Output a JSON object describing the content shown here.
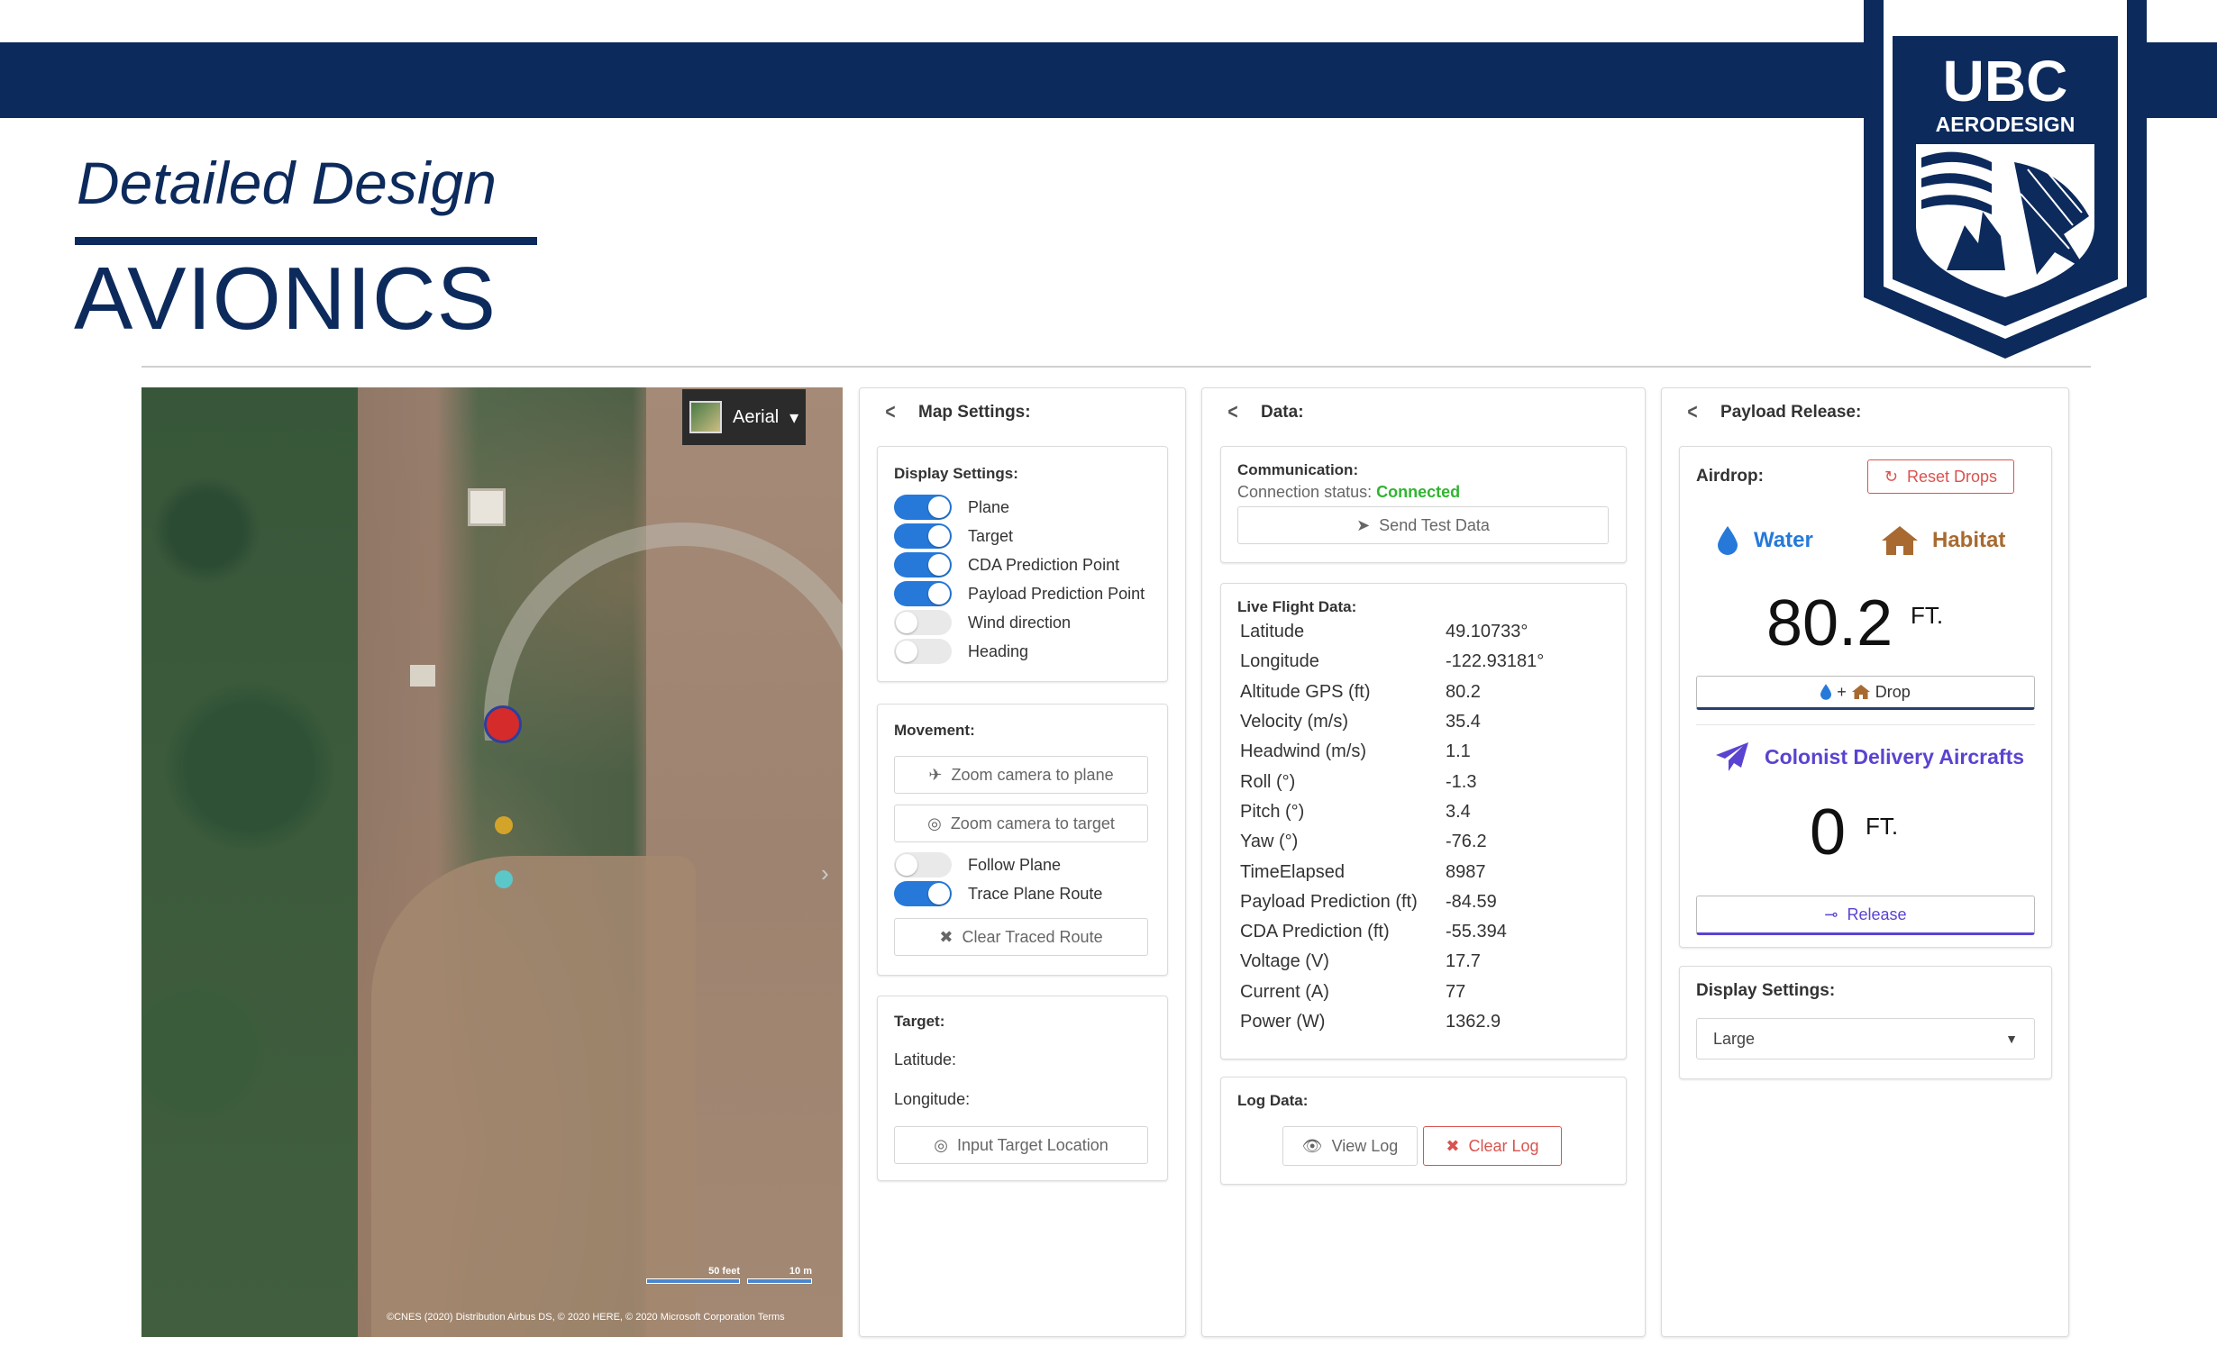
{
  "slide": {
    "subtitle": "Detailed Design",
    "title": "AVIONICS",
    "logo_line1": "UBC",
    "logo_line2": "AERODESIGN",
    "colors": {
      "navy": "#0c2a5c",
      "accent_blue": "#2679d9",
      "red": "#d9534f",
      "purple": "#5b43d1",
      "brown": "#b06a2b"
    }
  },
  "map": {
    "layer_label": "Aerial",
    "layer_icon": "chevron-down-icon",
    "scale_feet": "50 feet",
    "scale_meters": "10 m",
    "credit": "©CNES (2020) Distribution Airbus DS, © 2020 HERE, © 2020 Microsoft Corporation  Terms"
  },
  "map_settings": {
    "header": "Map Settings:",
    "display": {
      "title": "Display Settings:",
      "toggles": [
        {
          "label": "Plane",
          "on": true
        },
        {
          "label": "Target",
          "on": true
        },
        {
          "label": "CDA Prediction Point",
          "on": true
        },
        {
          "label": "Payload Prediction Point",
          "on": true
        },
        {
          "label": "Wind direction",
          "on": false
        },
        {
          "label": "Heading",
          "on": false
        }
      ]
    },
    "movement": {
      "title": "Movement:",
      "zoom_plane": "Zoom camera to plane",
      "zoom_target": "Zoom camera to target",
      "follow_plane": "Follow Plane",
      "follow_plane_on": false,
      "trace_route": "Trace Plane Route",
      "trace_route_on": true,
      "clear_route": "Clear Traced Route"
    },
    "target": {
      "title": "Target:",
      "latitude": "Latitude:",
      "longitude": "Longitude:",
      "input_button": "Input Target Location"
    }
  },
  "data_panel": {
    "header": "Data:",
    "communication": {
      "title": "Communication:",
      "status_label": "Connection status:",
      "status_value": "Connected",
      "send_button": "Send Test Data"
    },
    "live": {
      "title": "Live Flight Data:",
      "rows": [
        {
          "k": "Latitude",
          "v": "49.10733°"
        },
        {
          "k": "Longitude",
          "v": "-122.93181°"
        },
        {
          "k": "Altitude GPS (ft)",
          "v": "80.2"
        },
        {
          "k": "Velocity (m/s)",
          "v": "35.4"
        },
        {
          "k": "Headwind (m/s)",
          "v": "1.1"
        },
        {
          "k": "Roll (°)",
          "v": "-1.3"
        },
        {
          "k": "Pitch (°)",
          "v": "3.4"
        },
        {
          "k": "Yaw (°)",
          "v": "-76.2"
        },
        {
          "k": "TimeElapsed",
          "v": "8987"
        },
        {
          "k": "Payload Prediction (ft)",
          "v": "-84.59"
        },
        {
          "k": "CDA Prediction (ft)",
          "v": "-55.394"
        },
        {
          "k": "Voltage (V)",
          "v": "17.7"
        },
        {
          "k": "Current (A)",
          "v": "77"
        },
        {
          "k": "Power (W)",
          "v": "1362.9"
        }
      ]
    },
    "log": {
      "title": "Log Data:",
      "view_button": "View Log",
      "clear_button": "Clear Log"
    }
  },
  "payload": {
    "header": "Payload Release:",
    "airdrop": {
      "label": "Airdrop:",
      "reset_button": "Reset Drops",
      "water": "Water",
      "habitat": "Habitat",
      "value": "80.2",
      "unit": "FT.",
      "drop_plus": "+",
      "drop_button": "Drop"
    },
    "colonist": {
      "label": "Colonist Delivery Aircrafts",
      "value": "0",
      "unit": "FT.",
      "release_button": "Release"
    },
    "display": {
      "title": "Display Settings:",
      "selected": "Large"
    }
  }
}
